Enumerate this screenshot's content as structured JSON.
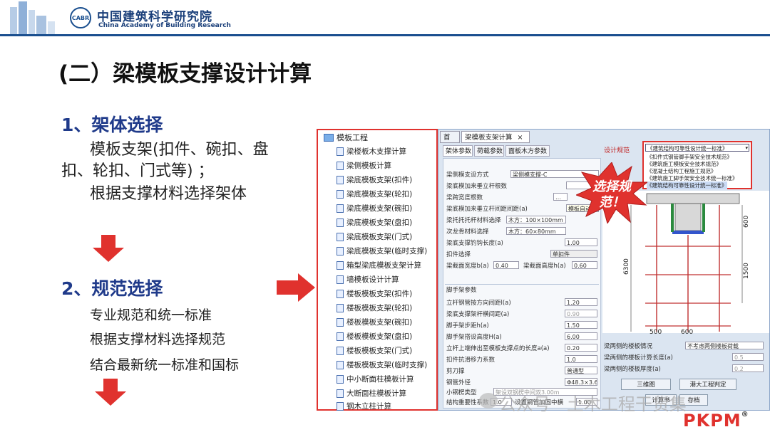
{
  "header": {
    "org_cn": "中国建筑科学研究院",
    "org_en": "China Academy of Building Research",
    "seal_text": "CABR"
  },
  "slide": {
    "title": "(二）梁模板支撑设计计算",
    "section1": "1、架体选择",
    "section1_line1": "模板支架(扣件、碗扣、盘扣、轮扣、门式等) ；",
    "section1_line2": "根据支撑材料选择架体",
    "section2": "2、规范选择",
    "section2_lines": [
      "专业规范和统一标准",
      "根据支撑材料选择规范",
      "结合最新统一标准和国标"
    ]
  },
  "tree": {
    "root": "模板工程",
    "items": [
      "梁楼板木支撑计算",
      "梁侧模板计算",
      "梁底模板支架(扣件)",
      "梁底模板支架(轮扣)",
      "梁底模板支架(碗扣)",
      "梁底模板支架(盘扣)",
      "梁底模板支架(门式)",
      "梁底模板支架(临时支撑)",
      "箱型梁底模板支架计算",
      "墙模板设计计算",
      "楼板模板支架(扣件)",
      "楼板模板支架(轮扣)",
      "楼板模板支架(碗扣)",
      "楼板模板支架(盘扣)",
      "楼板模板支架(门式)",
      "楼板模板支架(临时支撑)",
      "中小断面柱模板计算",
      "大断面柱模板计算",
      "钢木立柱计算"
    ]
  },
  "window": {
    "tab_home": "首页",
    "tab_active": "梁模板支架计算",
    "tab_close": "×",
    "subtabs": [
      "架体参数",
      "荷载参数",
      "面板木方参数"
    ],
    "spec_label": "设计规范",
    "spec_selected": "《建筑结构可靠性设计统一标准》",
    "spec_options": [
      "《扣件式钢管脚手架安全技术规范》",
      "《建筑施工模板安全技术规范》",
      "《混凝土结构工程施工规范》",
      "《建筑施工脚手架安全技术统一标准》",
      "《建筑结构可靠性设计统一标准》"
    ],
    "form": {
      "r1": {
        "label": "梁侧模支设方式",
        "value": "梁侧模支撑-C"
      },
      "r2": {
        "label": "梁底模加来垂立杆根数",
        "value": ""
      },
      "r3": {
        "label": "梁跨宽度根数",
        "value": "…"
      },
      "r4": {
        "label": "梁底模加来垂立杆间距间距(a)",
        "value": "模板自动设置"
      },
      "r5": {
        "label": "梁托托托杆材料选择",
        "value": "木方：100×100mm"
      },
      "r6": {
        "label": "次龙骨材料选择",
        "value": "木方：60×80mm"
      },
      "r7": {
        "label": "梁底支撑钓钩长度(a)",
        "value": "1.00"
      },
      "r8": {
        "label": "扣件选择",
        "value": "单扣件"
      },
      "r9": {
        "label": "梁截面宽度b(a)",
        "value": "0.40",
        "label2": "梁截面高度h(a)",
        "value2": "0.60"
      },
      "group": "脚手架参数",
      "g1": {
        "label": "立杆钢管按方向间距l(a)",
        "value": "1.20"
      },
      "g2": {
        "label": "梁底支撑架杆横间距(a)",
        "value": "0.90"
      },
      "g3": {
        "label": "脚手架步距h(a)",
        "value": "1.50"
      },
      "g4": {
        "label": "脚手架搭设高度H(a)",
        "value": "6.00"
      },
      "g5": {
        "label": "立杆上端伸出至模板支撑点的长度a(a)",
        "value": "0.20"
      },
      "g6": {
        "label": "扣件抗滑移力系数",
        "value": "1.0"
      },
      "g7": {
        "label": "剪刀撑",
        "value": "普通型"
      },
      "g8": {
        "label": "钢管外径",
        "value": "Φ48.3×3.6"
      },
      "g9": {
        "label": "小钢楞类型",
        "value": "架设双钢楞中间双3.00m"
      },
      "g10": {
        "label": "结构重要性系数",
        "value": "1.0",
        "label2": "设置钢管加固中横",
        "value2": "1.00"
      }
    },
    "bottom": {
      "b1": {
        "label": "梁两侧的楼板情况",
        "value": "不考虑两侧楼板荷载"
      },
      "b2": {
        "label": "梁两侧的楼板计算长度(a)",
        "value": "0.5"
      },
      "b3": {
        "label": "梁两侧的楼板厚度(a)",
        "value": "0.2"
      }
    },
    "buttons": [
      "三维图",
      "港大工程判定",
      "计算书",
      "存档"
    ],
    "drawing": {
      "dim_600": "600",
      "dim_1500": "1500",
      "dim_6300": "6300",
      "dim_500": "500",
      "dim_600b": "600"
    }
  },
  "callout": "选择规范！",
  "watermark": "公众号 · 土木工程干货集",
  "brand": "PKPM",
  "brand_mark": "®",
  "colors": {
    "accent_red": "#e0322e",
    "heading_blue": "#1f3a8a",
    "brand_blue": "#1a4f8f"
  }
}
